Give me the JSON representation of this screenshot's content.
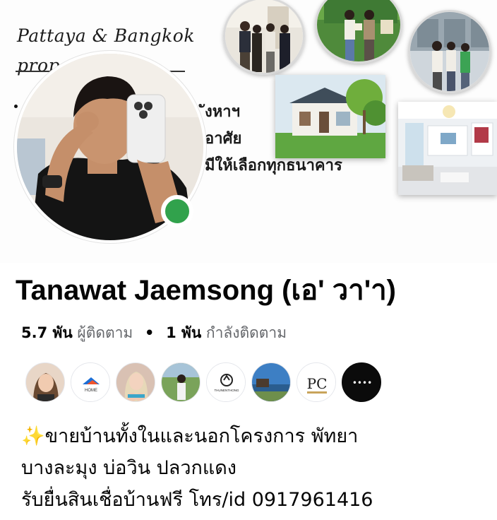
{
  "cover": {
    "title_line1": "Pattaya & Bangkok",
    "title_line2": "prope",
    "text_lines": [
      "ังหาฯ",
      "อาศัย",
      "มีให้เลือกทุกธนาคาร"
    ]
  },
  "profile": {
    "name": "Tanawat Jaemsong (เอ' วา'า)",
    "followers_count": "5.7 พัน",
    "followers_label": "ผู้ติดตาม",
    "separator": "•",
    "following_count": "1 พัน",
    "following_label": "กำลังติดตาม",
    "online_status_color": "#31a24c"
  },
  "friends": [
    {
      "icon": "avatar"
    },
    {
      "icon": "home-logo",
      "label": "HOME"
    },
    {
      "icon": "avatar"
    },
    {
      "icon": "avatar"
    },
    {
      "icon": "thunenthong-logo",
      "label": "THUNENTHONG"
    },
    {
      "icon": "avatar"
    },
    {
      "icon": "pc-logo",
      "label": "PC"
    },
    {
      "icon": "more-icon",
      "label": "••••"
    }
  ],
  "bio": {
    "sparkle": "✨",
    "line1": "ขายบ้านทั้งในและนอกโครงการ พัทยา",
    "line2": "บางละมุง บ่อวิน ปลวกแดง",
    "line3": "รับยื่นสินเชื่อบ้านฟรี โทร/id 0917961416"
  },
  "colors": {
    "text": "#050505",
    "secondary": "#65676b",
    "online": "#31a24c"
  }
}
